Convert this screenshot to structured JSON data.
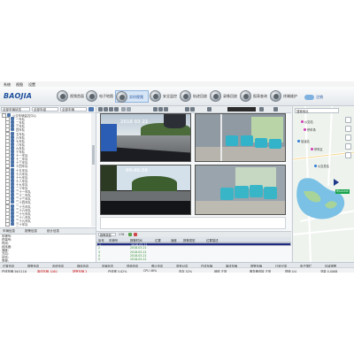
{
  "menu": [
    "系统",
    "视图",
    "设置"
  ],
  "header": {
    "logo": "BAOJIA",
    "nav": [
      {
        "label": "视频首面",
        "icon": "home-icon"
      },
      {
        "label": "电子地图",
        "icon": "map-icon"
      },
      {
        "label": "实时视频",
        "icon": "video-icon",
        "active": true
      },
      {
        "label": "安全监控",
        "icon": "shield-icon"
      },
      {
        "label": "轨迹回放",
        "icon": "track-icon"
      },
      {
        "label": "录像回放",
        "icon": "playback-icon"
      },
      {
        "label": "报表查询",
        "icon": "report-icon"
      },
      {
        "label": "终端维护",
        "icon": "maintenance-icon"
      }
    ],
    "logout": "注销"
  },
  "left": {
    "filters": [
      "全部车辆状态",
      "全部车组",
      "全部车辆"
    ],
    "tree": [
      "公交车辆监控中心",
      "一车队",
      "二车队",
      "三车队",
      "四车队",
      "五车队",
      "六车队",
      "七车队",
      "八车队",
      "九车队",
      "十车队",
      "十一车队",
      "十二车队",
      "十三车队",
      "十四车队",
      "十五车队",
      "十六车队",
      "十七车队",
      "十八车队",
      "十九车队",
      "二十车队",
      "二十一车队",
      "二十二车队",
      "二十三车队",
      "二十四车队",
      "二十五车队",
      "二十六车队",
      "二十七车队",
      "二十八车队",
      "二十九车队",
      "三十车队"
    ],
    "info_tabs": [
      "车辆信息",
      "报警信息",
      "统计信息"
    ],
    "info": [
      {
        "k": "车牌号:",
        "v": ""
      },
      {
        "k": "终端号:",
        "v": ""
      },
      {
        "k": "时间:",
        "v": ""
      },
      {
        "k": "经纬度:",
        "v": ""
      },
      {
        "k": "速度:",
        "v": ""
      },
      {
        "k": "方向:",
        "v": ""
      },
      {
        "k": "状态:",
        "v": ""
      },
      {
        "k": "里程:",
        "v": ""
      },
      {
        "k": "位置信息:",
        "v": ""
      },
      {
        "k": "报警:",
        "v": "",
        "red": true
      },
      {
        "k": "司机:",
        "v": ""
      }
    ]
  },
  "center": {
    "watermarks": [
      "2018 03 21",
      "09:40:38"
    ],
    "table_tools": {
      "selector": "报警类型",
      "count": "176"
    },
    "table_headers": [
      "序号",
      "车牌号",
      "报警时间",
      "位置",
      "速度",
      "报警类型",
      "位置描述"
    ],
    "rows": [
      {
        "no": "1",
        "plate": "",
        "time": "2018-03-21",
        "desc": "",
        "selected": true
      },
      {
        "no": "2",
        "plate": "",
        "time": "2018-03-21",
        "desc": ""
      },
      {
        "no": "3",
        "plate": "",
        "time": "2018-03-21",
        "desc": ""
      },
      {
        "no": "4",
        "plate": "",
        "time": "2018-03-21",
        "desc": ""
      },
      {
        "no": "5",
        "plate": "",
        "time": "2018-03-21",
        "desc": ""
      },
      {
        "no": "6",
        "plate": "",
        "time": "2018-03-21",
        "desc": ""
      }
    ]
  },
  "bottom_tabs": [
    "位置信息",
    "报警信息",
    "系统信息",
    "媒体信息",
    "车辆状态",
    "视频信息",
    "照片信息",
    "语音对讲",
    "在线车辆",
    "离线车辆",
    "报警车辆",
    "行驶记录",
    "电子围栏",
    "区域报警"
  ],
  "status": [
    {
      "text": "在线车辆 56/1116",
      "color": "#333333"
    },
    {
      "text": "离线车辆 1060",
      "color": "#cc2020"
    },
    {
      "text": "报警车辆 3",
      "color": "#cc2020"
    },
    {
      "text": "在线率 5.02%",
      "color": "#333333"
    },
    {
      "text": "CPU 48%",
      "color": "#333333"
    },
    {
      "text": "内存 52%",
      "color": "#333333"
    },
    {
      "text": "网络 正常",
      "color": "#333333"
    },
    {
      "text": "服务器连接 正常",
      "color": "#333333"
    },
    {
      "text": "视频 4/4",
      "color": "#333333"
    },
    {
      "text": "流量 0.00KB",
      "color": "#333333"
    }
  ],
  "map": {
    "search_placeholder": "搜索地点",
    "pois": [
      "公交站",
      "停车场",
      "加油站",
      "停车区",
      "公交总站"
    ],
    "vehicle_label": "粤A12345"
  }
}
